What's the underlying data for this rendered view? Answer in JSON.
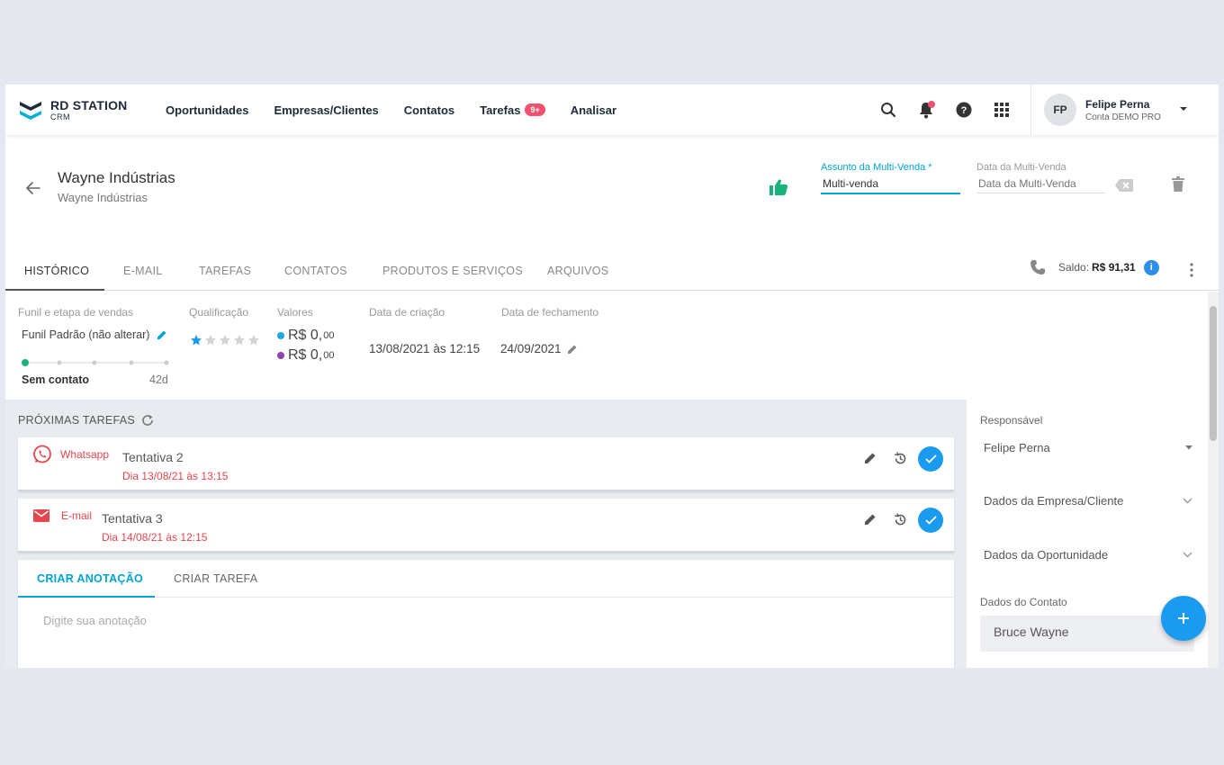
{
  "brand": {
    "name": "RD STATION",
    "sub": "CRM"
  },
  "nav": {
    "links": [
      "Oportunidades",
      "Empresas/Clientes",
      "Contatos",
      "Tarefas",
      "Analisar"
    ],
    "tasks_badge": "9+"
  },
  "user": {
    "initials": "FP",
    "name": "Felipe Perna",
    "account": "Conta DEMO PRO"
  },
  "deal": {
    "title": "Wayne Indústrias",
    "subtitle": "Wayne Indústrias",
    "subject_label": "Assunto da Multi-Venda *",
    "subject_value": "Multi-venda",
    "date_label": "Data da Multi-Venda",
    "date_placeholder": "Data da Multi-Venda"
  },
  "tabs": [
    "HISTÓRICO",
    "E-MAIL",
    "TAREFAS",
    "CONTATOS",
    "PRODUTOS E SERVIÇOS",
    "ARQUIVOS"
  ],
  "saldo": {
    "label": "Saldo:",
    "value": "R$ 91,31"
  },
  "info": {
    "funil_label": "Funil e etapa de vendas",
    "funil_value": "Funil Padrão (não alterar)",
    "stage": "Sem contato",
    "days": "42d",
    "qualificacao_label": "Qualificação",
    "rating": 1,
    "valores_label": "Valores",
    "valor1": "R$ 0,",
    "valor1_cents": "00",
    "valor2": "R$ 0,",
    "valor2_cents": "00",
    "criacao_label": "Data de criação",
    "criacao_value": "13/08/2021 às 12:15",
    "fechamento_label": "Data de fechamento",
    "fechamento_value": "24/09/2021"
  },
  "tasks_section": {
    "title": "PRÓXIMAS TAREFAS",
    "items": [
      {
        "type": "Whatsapp",
        "name": "Tentativa 2",
        "date": "Dia 13/08/21 às 13:15"
      },
      {
        "type": "E-mail",
        "name": "Tentativa 3",
        "date": "Dia 14/08/21 às 12:15"
      }
    ]
  },
  "note": {
    "tab1": "CRIAR ANOTAÇÃO",
    "tab2": "CRIAR TAREFA",
    "placeholder": "Digite sua anotação"
  },
  "right_panel": {
    "responsavel_label": "Responsável",
    "responsavel_value": "Felipe Perna",
    "empresa_section": "Dados da Empresa/Cliente",
    "oportunidade_section": "Dados da Oportunidade",
    "contato_label": "Dados do Contato",
    "contato_value": "Bruce Wayne"
  },
  "colors": {
    "accent": "#00a4d3",
    "primary_button": "#1a9bf0",
    "alert": "#e5464d",
    "success": "#1ab17d"
  }
}
